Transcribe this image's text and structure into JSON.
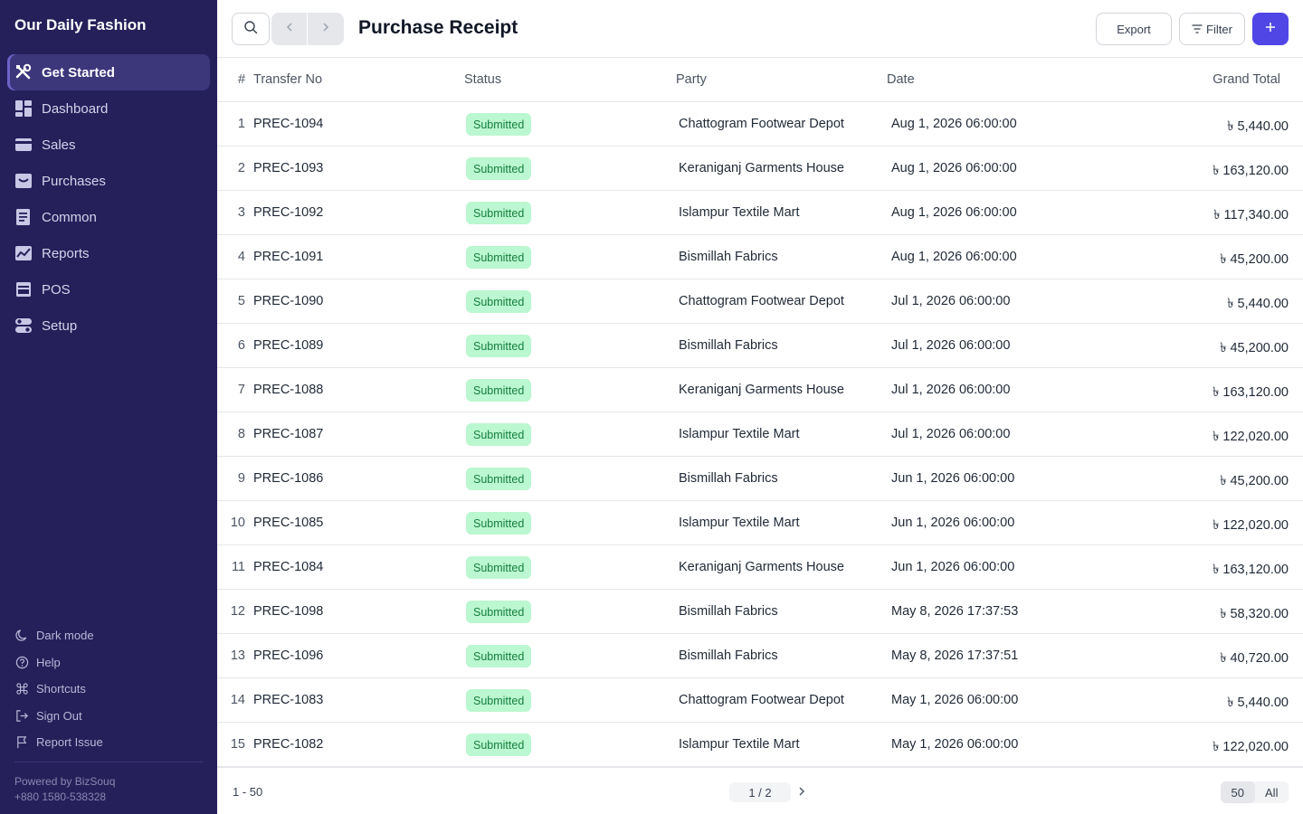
{
  "app": {
    "brand": "Our Daily Fashion"
  },
  "sidebar": {
    "items": [
      {
        "label": "Get Started",
        "icon": "tools-icon",
        "active": true
      },
      {
        "label": "Dashboard",
        "icon": "dashboard-icon"
      },
      {
        "label": "Sales",
        "icon": "card-icon"
      },
      {
        "label": "Purchases",
        "icon": "inbox-icon"
      },
      {
        "label": "Common",
        "icon": "document-icon"
      },
      {
        "label": "Reports",
        "icon": "chart-icon"
      },
      {
        "label": "POS",
        "icon": "pos-icon"
      },
      {
        "label": "Setup",
        "icon": "toggle-icon"
      }
    ],
    "bottom": [
      {
        "label": "Dark mode",
        "icon": "moon-icon"
      },
      {
        "label": "Help",
        "icon": "help-icon"
      },
      {
        "label": "Shortcuts",
        "icon": "command-icon"
      },
      {
        "label": "Sign Out",
        "icon": "sign-out-icon"
      },
      {
        "label": "Report Issue",
        "icon": "flag-icon"
      }
    ],
    "powered_by": "Powered by BizSouq",
    "phone": "+880 1580-538328"
  },
  "header": {
    "title": "Purchase Receipt",
    "export_label": "Export",
    "filter_label": "Filter"
  },
  "table": {
    "columns": {
      "hash": "#",
      "no": "Transfer No",
      "status": "Status",
      "party": "Party",
      "date": "Date",
      "total": "Grand Total"
    },
    "rows": [
      {
        "idx": "1",
        "no": "PREC-1094",
        "status": "Submitted",
        "party": "Chattogram Footwear Depot",
        "date": "Aug 1, 2026 06:00:00",
        "total": "৳ 5,440.00"
      },
      {
        "idx": "2",
        "no": "PREC-1093",
        "status": "Submitted",
        "party": "Keraniganj Garments House",
        "date": "Aug 1, 2026 06:00:00",
        "total": "৳ 163,120.00"
      },
      {
        "idx": "3",
        "no": "PREC-1092",
        "status": "Submitted",
        "party": "Islampur Textile Mart",
        "date": "Aug 1, 2026 06:00:00",
        "total": "৳ 117,340.00"
      },
      {
        "idx": "4",
        "no": "PREC-1091",
        "status": "Submitted",
        "party": "Bismillah Fabrics",
        "date": "Aug 1, 2026 06:00:00",
        "total": "৳ 45,200.00"
      },
      {
        "idx": "5",
        "no": "PREC-1090",
        "status": "Submitted",
        "party": "Chattogram Footwear Depot",
        "date": "Jul 1, 2026 06:00:00",
        "total": "৳ 5,440.00"
      },
      {
        "idx": "6",
        "no": "PREC-1089",
        "status": "Submitted",
        "party": "Bismillah Fabrics",
        "date": "Jul 1, 2026 06:00:00",
        "total": "৳ 45,200.00"
      },
      {
        "idx": "7",
        "no": "PREC-1088",
        "status": "Submitted",
        "party": "Keraniganj Garments House",
        "date": "Jul 1, 2026 06:00:00",
        "total": "৳ 163,120.00"
      },
      {
        "idx": "8",
        "no": "PREC-1087",
        "status": "Submitted",
        "party": "Islampur Textile Mart",
        "date": "Jul 1, 2026 06:00:00",
        "total": "৳ 122,020.00"
      },
      {
        "idx": "9",
        "no": "PREC-1086",
        "status": "Submitted",
        "party": "Bismillah Fabrics",
        "date": "Jun 1, 2026 06:00:00",
        "total": "৳ 45,200.00"
      },
      {
        "idx": "10",
        "no": "PREC-1085",
        "status": "Submitted",
        "party": "Islampur Textile Mart",
        "date": "Jun 1, 2026 06:00:00",
        "total": "৳ 122,020.00"
      },
      {
        "idx": "11",
        "no": "PREC-1084",
        "status": "Submitted",
        "party": "Keraniganj Garments House",
        "date": "Jun 1, 2026 06:00:00",
        "total": "৳ 163,120.00"
      },
      {
        "idx": "12",
        "no": "PREC-1098",
        "status": "Submitted",
        "party": "Bismillah Fabrics",
        "date": "May 8, 2026 17:37:53",
        "total": "৳ 58,320.00"
      },
      {
        "idx": "13",
        "no": "PREC-1096",
        "status": "Submitted",
        "party": "Bismillah Fabrics",
        "date": "May 8, 2026 17:37:51",
        "total": "৳ 40,720.00"
      },
      {
        "idx": "14",
        "no": "PREC-1083",
        "status": "Submitted",
        "party": "Chattogram Footwear Depot",
        "date": "May 1, 2026 06:00:00",
        "total": "৳ 5,440.00"
      },
      {
        "idx": "15",
        "no": "PREC-1082",
        "status": "Submitted",
        "party": "Islampur Textile Mart",
        "date": "May 1, 2026 06:00:00",
        "total": "৳ 122,020.00"
      }
    ]
  },
  "footer": {
    "range": "1 - 50",
    "page": "1 / 2",
    "per_page": [
      "50",
      "All"
    ],
    "selected_per_page": "50"
  },
  "colors": {
    "sidebar_bg": "#25205a",
    "active_bg": "#3c367b",
    "accent": "#4f46e5",
    "status_bg": "#bbf7d0",
    "status_text": "#15803d"
  }
}
